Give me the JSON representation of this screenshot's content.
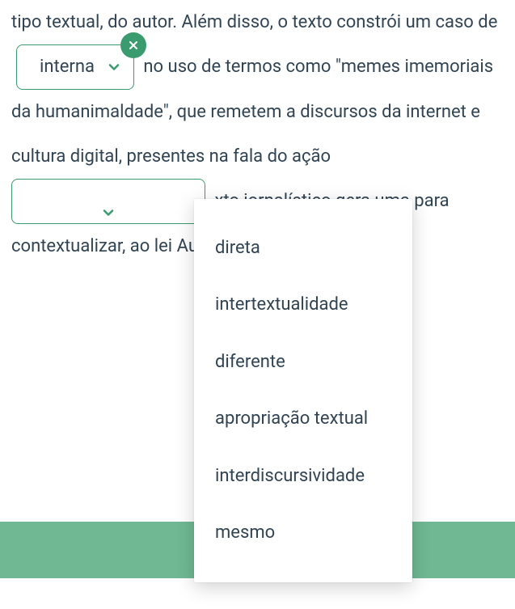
{
  "para": {
    "t1": "tipo textual, do autor. Além disso, o texto constrói um caso de",
    "t2": "no uso de termos como \"memes imemoriais da humanimaldade\", que remetem a discursos da internet e cultura digital, presentes na fala do",
    "t2b": "ação",
    "t3a": "xto jornalístico gera uma",
    "t3b": "para contextualizar, ao lei",
    "t3c": "Augusto de Campos."
  },
  "dropdown1": {
    "selected": "interna"
  },
  "dropdown2": {
    "selected": ""
  },
  "options": [
    "direta",
    "intertextualidade",
    "diferente",
    "apropriação textual",
    "interdiscursividade",
    "mesmo"
  ],
  "colors": {
    "accent": "#3a9b6e",
    "bottom": "#6fb893",
    "text": "#314453"
  }
}
